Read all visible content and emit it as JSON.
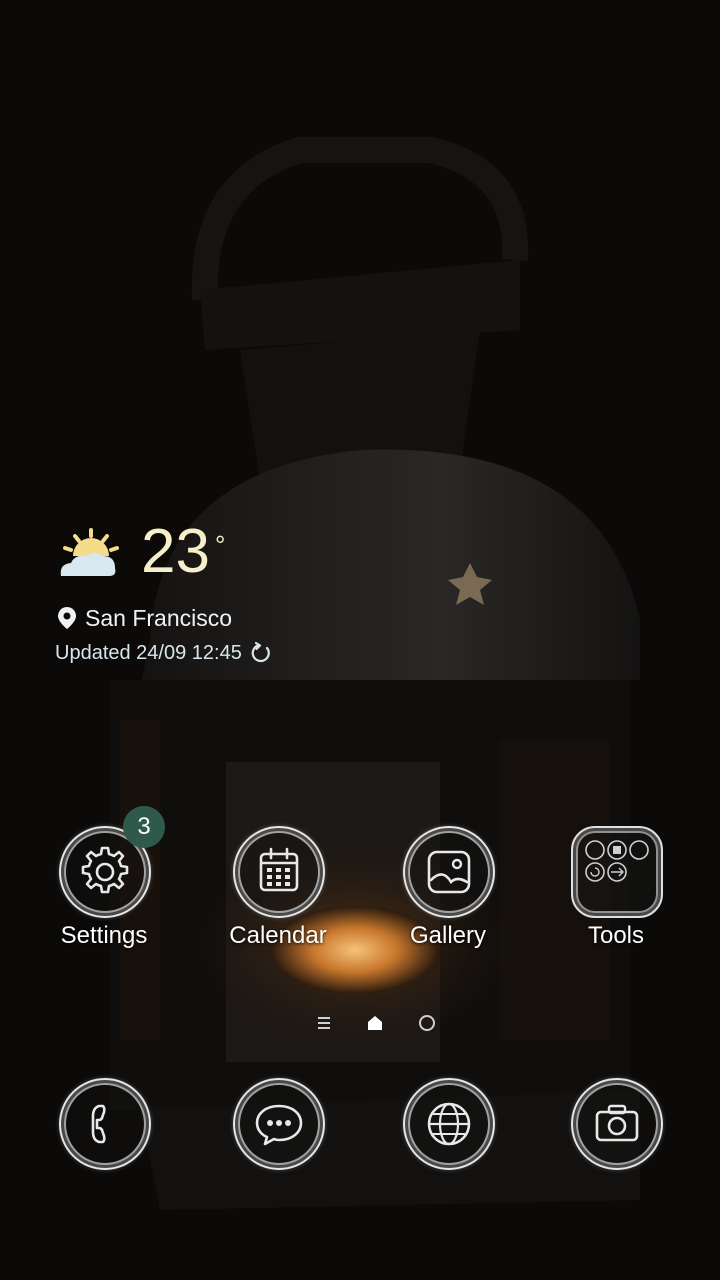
{
  "weather": {
    "temperature": "23",
    "degree_symbol": "°",
    "location": "San Francisco",
    "updated": "Updated 24/09 12:45",
    "icon": "partly-cloudy-icon"
  },
  "apps": {
    "settings": {
      "label": "Settings",
      "badge": "3",
      "icon": "gear-icon"
    },
    "calendar": {
      "label": "Calendar",
      "icon": "calendar-icon"
    },
    "gallery": {
      "label": "Gallery",
      "icon": "picture-icon"
    },
    "tools": {
      "label": "Tools",
      "icon": "folder-icon"
    }
  },
  "dock": {
    "phone": {
      "icon": "phone-icon"
    },
    "messages": {
      "icon": "chat-bubble-icon"
    },
    "internet": {
      "icon": "globe-icon"
    },
    "camera": {
      "icon": "camera-icon"
    }
  },
  "pager": {
    "pages": [
      "menu-page",
      "home-page",
      "page"
    ],
    "active_index": 1
  },
  "colors": {
    "temperature": "#f6efc7",
    "badge": "#2f5a4b",
    "candle_glow": "#f0a24a"
  }
}
